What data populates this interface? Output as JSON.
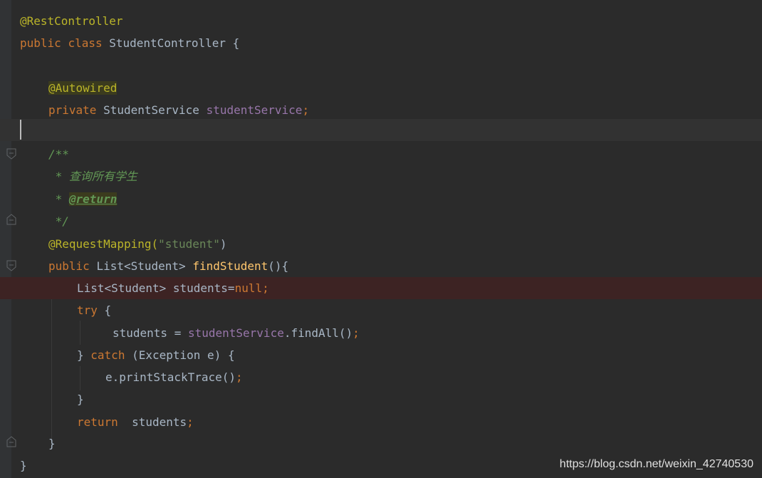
{
  "code": {
    "l1_annotation": "@RestController",
    "l2_public": "public",
    "l2_class": "class",
    "l2_name": "StudentController",
    "l2_brace": "{",
    "l4_annotation": "@Autowired",
    "l5_private": "private",
    "l5_type": "StudentService",
    "l5_field": "studentService",
    "l5_semi": ";",
    "l7_comment": "/**",
    "l8_comment": " * 查询所有学生",
    "l9_star": " * ",
    "l9_tag": "@return",
    "l10_comment": " */",
    "l11_annotation": "@RequestMapping(",
    "l11_string": "\"student\"",
    "l11_close": ")",
    "l12_public": "public",
    "l12_type": "List<Student>",
    "l12_method": "findStudent",
    "l12_rest": "(){",
    "l13_decl": "List<Student> students=",
    "l13_null": "null",
    "l13_semi": ";",
    "l14_try": "try",
    "l14_brace": "{",
    "l15_lhs": "students = ",
    "l15_field": "studentService",
    "l15_call": ".findAll()",
    "l15_semi": ";",
    "l16_close": "}",
    "l16_catch": "catch",
    "l16_rest": "(Exception e) {",
    "l17_call": "e.printStackTrace()",
    "l17_semi": ";",
    "l18_close": "}",
    "l19_return": "return",
    "l19_var": "  students",
    "l19_semi": ";",
    "l20_close": "}",
    "l21_close": "}"
  },
  "watermark": "https://blog.csdn.net/weixin_42740530"
}
